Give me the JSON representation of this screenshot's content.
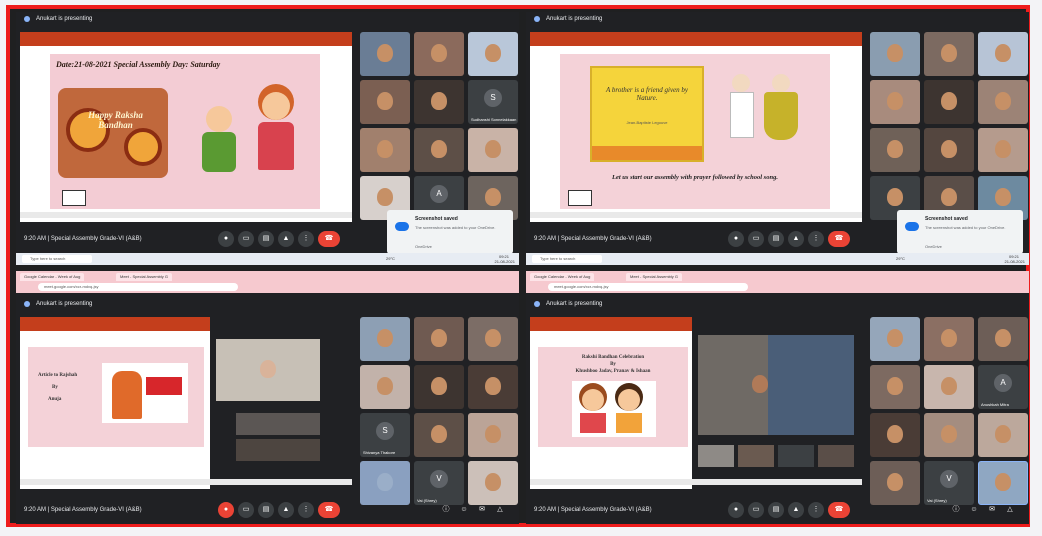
{
  "presenting": "Anukart is presenting",
  "meeting": {
    "time": "9:20 AM",
    "name": "Special Assembly Grade-VI (A&B)"
  },
  "panel1": {
    "slide_title": "Date:21-08-2021    Special Assembly    Day: Saturday",
    "slide_art": "Happy Raksha Bandhan",
    "tiles": [
      "",
      "",
      "",
      "",
      "",
      "Sudhanshi Sonnelakkaan",
      "",
      "",
      "",
      "",
      "",
      ""
    ]
  },
  "panel2": {
    "quote": "A brother is a friend given by Nature.",
    "quote_author": "Jean-Baptiste Legouve",
    "bottom_line": "Let us start our assembly with prayer followed by school song."
  },
  "panel3": {
    "slide_line1": "Article to Rajshah",
    "slide_line2": "By",
    "slide_line3": "Anuja",
    "tiles": [
      "",
      "",
      "",
      "",
      "",
      "",
      "Shivanya Thakore",
      "",
      "",
      "",
      "Vai (Shrey)",
      ""
    ]
  },
  "panel4": {
    "slide_line1": "Rakshi Bandhan Celebration",
    "slide_line2": "By",
    "slide_line3": "Khushboo Jadav, Pranav & Ishaan",
    "tiles": [
      "",
      "",
      "",
      "",
      "",
      "Anushkah Mitra",
      "",
      "",
      "",
      "",
      "Vai (Shrey)",
      ""
    ]
  },
  "toast": {
    "title": "Screenshot saved",
    "body": "The screenshot was added to your OneDrive.",
    "link": "OneDrive"
  },
  "taskbar": {
    "search": "Type here to search",
    "time": "09:21",
    "date": "21-08-2021",
    "weather": "29°C"
  },
  "browser": {
    "tab1": "Google Calendar - Week of Aug",
    "tab2": "Meet - Special Assembly G",
    "url": "meet.google.com/xcr-mdvq-jsy"
  }
}
